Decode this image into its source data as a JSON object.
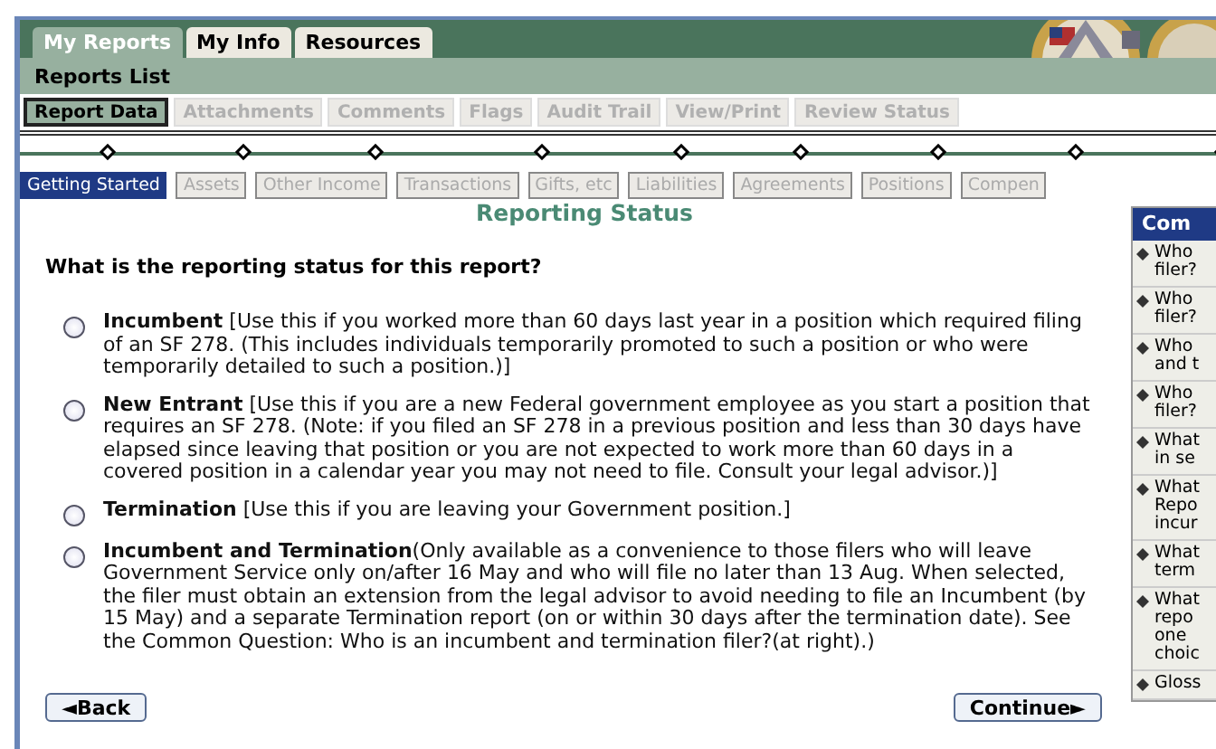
{
  "top_tabs": [
    {
      "label": "My Reports",
      "selected": true
    },
    {
      "label": "My Info",
      "selected": false
    },
    {
      "label": "Resources",
      "selected": false
    }
  ],
  "section_title": "Reports List",
  "sub_tabs": [
    {
      "label": "Report Data",
      "selected": true
    },
    {
      "label": "Attachments",
      "selected": false
    },
    {
      "label": "Comments",
      "selected": false
    },
    {
      "label": "Flags",
      "selected": false
    },
    {
      "label": "Audit Trail",
      "selected": false
    },
    {
      "label": "View/Print",
      "selected": false
    },
    {
      "label": "Review Status",
      "selected": false
    }
  ],
  "steps": [
    {
      "label": "Getting Started",
      "selected": true
    },
    {
      "label": "Assets",
      "selected": false
    },
    {
      "label": "Other Income",
      "selected": false
    },
    {
      "label": "Transactions",
      "selected": false
    },
    {
      "label": "Gifts, etc",
      "selected": false
    },
    {
      "label": "Liabilities",
      "selected": false
    },
    {
      "label": "Agreements",
      "selected": false
    },
    {
      "label": "Positions",
      "selected": false
    },
    {
      "label": "Compen",
      "selected": false
    }
  ],
  "page_title": "Reporting Status",
  "question": "What is the reporting status for this report?",
  "options": [
    {
      "text": "**Incumbent** [Use this if you worked more than 60 days last year in a position which required filing of an SF 278. (This includes individuals temporarily promoted to such a position or who were temporarily detailed to such a position.)]",
      "selected": false
    },
    {
      "text": "**New Entrant** [Use this if you are a new Federal government employee as you start a position that requires an SF 278. (Note: if you filed an SF 278 in a previous position and less than 30 days have elapsed since leaving that position or you are not expected to work more than 60 days in a covered position in a calendar year you may not need to file. Consult your legal advisor.)]",
      "selected": false
    },
    {
      "text": "**Termination** [Use this if you are leaving your Government position.]",
      "selected": false
    },
    {
      "text": "**Incumbent and Termination**(Only available as a convenience to those filers who will leave Government Service only on/after 16 May and who will file no later than 13 Aug. When selected, the filer must obtain an extension from the legal advisor to avoid needing to file an Incumbent (by 15 May) and a separate Termination report (on or within 30 days after the termination date). See the Common Question: Who is an incumbent and termination filer?(at right).)",
      "selected": false
    }
  ],
  "buttons": {
    "back": "◄Back",
    "continue": "Continue►"
  },
  "side_panel": {
    "title": "Com",
    "items": [
      [
        "Who",
        "filer?"
      ],
      [
        "Who",
        "filer?"
      ],
      [
        "Who",
        "and t"
      ],
      [
        "Who",
        "filer?"
      ],
      [
        "What",
        "in se"
      ],
      [
        "What",
        "Repo",
        "incur"
      ],
      [
        "What",
        "term"
      ],
      [
        "What",
        "repo",
        "one",
        "choic"
      ],
      [
        "Gloss"
      ]
    ]
  }
}
